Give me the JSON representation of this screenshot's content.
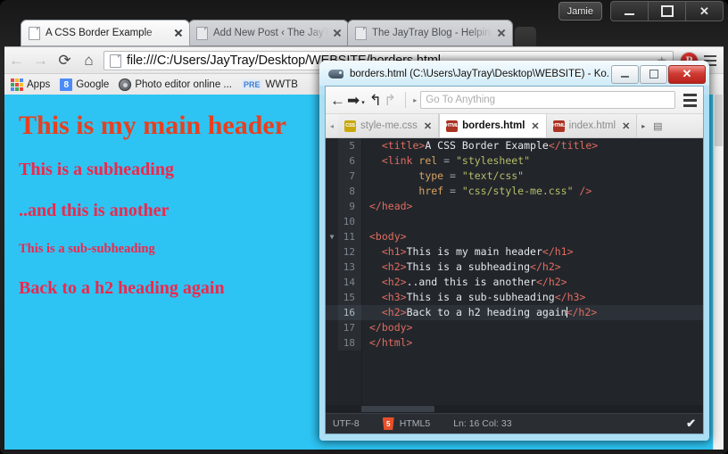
{
  "browser": {
    "user_badge": "Jamie",
    "window_controls": {
      "minimize": "—",
      "maximize": "□",
      "close": "✕"
    },
    "tabs": [
      {
        "title": "A CSS Border Example",
        "active": true
      },
      {
        "title": "Add New Post ‹ The JayTr",
        "active": false
      },
      {
        "title": "The JayTray Blog - Helping",
        "active": false
      }
    ],
    "toolbar": {
      "back": "←",
      "forward": "→",
      "reload": "⟳",
      "home": "⌂",
      "url": "file:///C:/Users/JayTray/Desktop/WEBSITE/borders.html",
      "star": "★",
      "pinterest": "P",
      "menu": "menu"
    },
    "bookmarks": [
      {
        "label": "Apps",
        "icon": "apps-grid-icon"
      },
      {
        "label": "Google",
        "icon": "google-icon"
      },
      {
        "label": "Photo editor online ...",
        "icon": "photo-editor-icon"
      },
      {
        "label": "WWTB",
        "icon": "pre-icon",
        "badge": "PRE"
      }
    ]
  },
  "webpage": {
    "background_color": "#2dc4f3",
    "h1_color": "#e8401f",
    "h2_color": "#f0274b",
    "headings": [
      {
        "tag": "h1",
        "text": "This is my main header"
      },
      {
        "tag": "h2",
        "text": "This is a subheading"
      },
      {
        "tag": "h2",
        "text": "..and this is another"
      },
      {
        "tag": "h3",
        "text": "This is a sub-subheading"
      },
      {
        "tag": "h2",
        "text": "Back to a h2 heading again"
      }
    ]
  },
  "komodo": {
    "title": "borders.html (C:\\Users\\JayTray\\Desktop\\WEBSITE) - Ko...",
    "window_controls": {
      "minimize": "—",
      "maximize": "□",
      "close": "✕"
    },
    "toolbar": {
      "back": "←",
      "forward": "➡",
      "forward_caret": "▾",
      "undo": "↰",
      "redo": "↱",
      "expand_caret": "▸",
      "goto_placeholder": "Go To Anything",
      "menu": "menu"
    },
    "tabs": [
      {
        "label": "style-me.css",
        "type": "CSS",
        "active": false
      },
      {
        "label": "borders.html",
        "type": "HTML",
        "active": true
      },
      {
        "label": "index.html",
        "type": "HTML",
        "active": false
      }
    ],
    "tab_scroll_left": "◂",
    "tab_scroll_right": "▸",
    "code_lines": [
      {
        "num": "5",
        "fold": "",
        "current": false,
        "indent": 2,
        "parts": [
          {
            "t": "tg",
            "v": "<title>"
          },
          {
            "t": "tx",
            "v": "A CSS Border Example"
          },
          {
            "t": "tg",
            "v": "</title>"
          }
        ]
      },
      {
        "num": "6",
        "fold": "",
        "current": false,
        "indent": 2,
        "parts": [
          {
            "t": "tg",
            "v": "<link "
          },
          {
            "t": "at",
            "v": "rel"
          },
          {
            "t": "op",
            "v": " = "
          },
          {
            "t": "st",
            "v": "\"stylesheet\""
          }
        ]
      },
      {
        "num": "7",
        "fold": "",
        "current": false,
        "indent": 8,
        "parts": [
          {
            "t": "at",
            "v": "type"
          },
          {
            "t": "op",
            "v": " = "
          },
          {
            "t": "st",
            "v": "\"text/css\""
          }
        ]
      },
      {
        "num": "8",
        "fold": "",
        "current": false,
        "indent": 8,
        "parts": [
          {
            "t": "at",
            "v": "href"
          },
          {
            "t": "op",
            "v": " = "
          },
          {
            "t": "st",
            "v": "\"css/style-me.css\""
          },
          {
            "t": "tg",
            "v": " />"
          }
        ]
      },
      {
        "num": "9",
        "fold": "",
        "current": false,
        "indent": 0,
        "parts": [
          {
            "t": "tg",
            "v": "</head>"
          }
        ]
      },
      {
        "num": "10",
        "fold": "",
        "current": false,
        "indent": 0,
        "parts": []
      },
      {
        "num": "11",
        "fold": "▼",
        "current": false,
        "indent": 0,
        "parts": [
          {
            "t": "tg",
            "v": "<body>"
          }
        ]
      },
      {
        "num": "12",
        "fold": "",
        "current": false,
        "indent": 2,
        "parts": [
          {
            "t": "tg",
            "v": "<h1>"
          },
          {
            "t": "tx",
            "v": "This is my main header"
          },
          {
            "t": "tg",
            "v": "</h1>"
          }
        ]
      },
      {
        "num": "13",
        "fold": "",
        "current": false,
        "indent": 2,
        "parts": [
          {
            "t": "tg",
            "v": "<h2>"
          },
          {
            "t": "tx",
            "v": "This is a subheading"
          },
          {
            "t": "tg",
            "v": "</h2>"
          }
        ]
      },
      {
        "num": "14",
        "fold": "",
        "current": false,
        "indent": 2,
        "parts": [
          {
            "t": "tg",
            "v": "<h2>"
          },
          {
            "t": "tx",
            "v": "..and this is another"
          },
          {
            "t": "tg",
            "v": "</h2>"
          }
        ]
      },
      {
        "num": "15",
        "fold": "",
        "current": false,
        "indent": 2,
        "parts": [
          {
            "t": "tg",
            "v": "<h3>"
          },
          {
            "t": "tx",
            "v": "This is a sub-subheading"
          },
          {
            "t": "tg",
            "v": "</h3>"
          }
        ]
      },
      {
        "num": "16",
        "fold": "",
        "current": true,
        "indent": 2,
        "caret_after": 1,
        "parts": [
          {
            "t": "tg",
            "v": "<h2>"
          },
          {
            "t": "tx",
            "v": "Back to a h2 heading again"
          },
          {
            "t": "tg",
            "v": "</h2>"
          }
        ]
      },
      {
        "num": "17",
        "fold": "",
        "current": false,
        "indent": 0,
        "parts": [
          {
            "t": "tg",
            "v": "</body>"
          }
        ]
      },
      {
        "num": "18",
        "fold": "",
        "current": false,
        "indent": 0,
        "parts": [
          {
            "t": "tg",
            "v": "</html>"
          }
        ]
      }
    ],
    "status": {
      "encoding": "UTF-8",
      "language": "HTML5",
      "language_icon": "5",
      "position": "Ln: 16 Col: 33",
      "check": "✔"
    }
  }
}
